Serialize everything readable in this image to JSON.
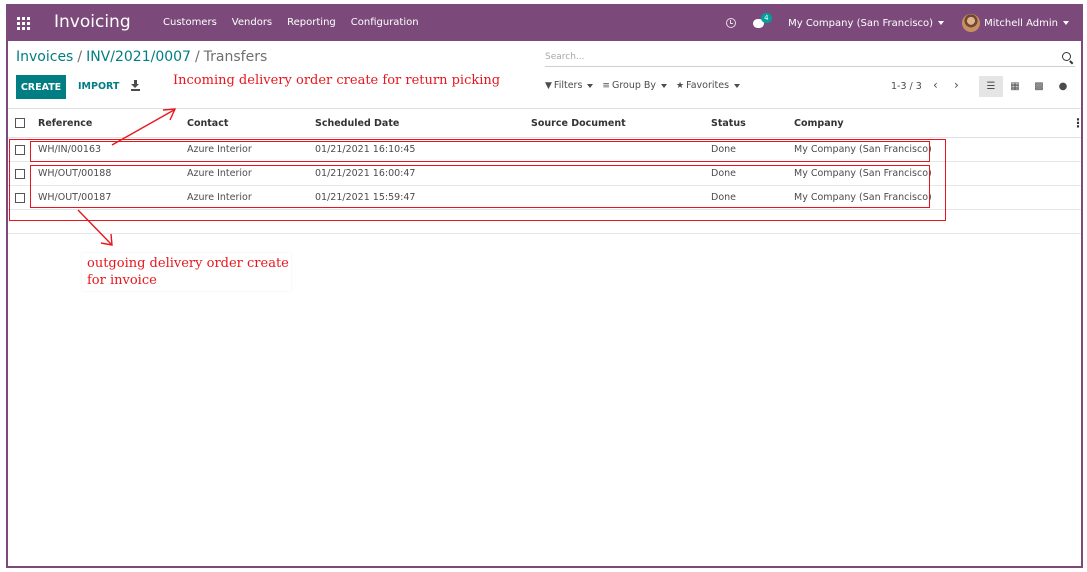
{
  "navbar": {
    "app_title": "Invoicing",
    "menu": [
      "Customers",
      "Vendors",
      "Reporting",
      "Configuration"
    ],
    "chat_count": "4",
    "company": "My Company (San Francisco)",
    "user": "Mitchell Admin",
    "bar_color": "#7c4a7a"
  },
  "breadcrumb": {
    "items": [
      "Invoices",
      "INV/2021/0007"
    ],
    "current": "Transfers"
  },
  "search": {
    "placeholder": "Search..."
  },
  "buttons": {
    "create": "CREATE",
    "import": "IMPORT"
  },
  "filters": {
    "filters": "Filters",
    "group_by": "Group By",
    "favorites": "Favorites"
  },
  "pager": {
    "text": "1-3 / 3"
  },
  "table": {
    "columns": [
      "Reference",
      "Contact",
      "Scheduled Date",
      "Source Document",
      "Status",
      "Company"
    ],
    "rows": [
      {
        "reference": "WH/IN/00163",
        "contact": "Azure Interior",
        "scheduled_date": "01/21/2021 16:10:45",
        "source_document": "",
        "status": "Done",
        "company": "My Company (San Francisco)"
      },
      {
        "reference": "WH/OUT/00188",
        "contact": "Azure Interior",
        "scheduled_date": "01/21/2021 16:00:47",
        "source_document": "",
        "status": "Done",
        "company": "My Company (San Francisco)"
      },
      {
        "reference": "WH/OUT/00187",
        "contact": "Azure Interior",
        "scheduled_date": "01/21/2021 15:59:47",
        "source_document": "",
        "status": "Done",
        "company": "My Company (San Francisco)"
      }
    ]
  },
  "annotations": {
    "incoming": "Incoming delivery order create for return picking",
    "outgoing_line1": "outgoing delivery order create",
    "outgoing_line2": "for invoice",
    "color": "#e8161c"
  }
}
